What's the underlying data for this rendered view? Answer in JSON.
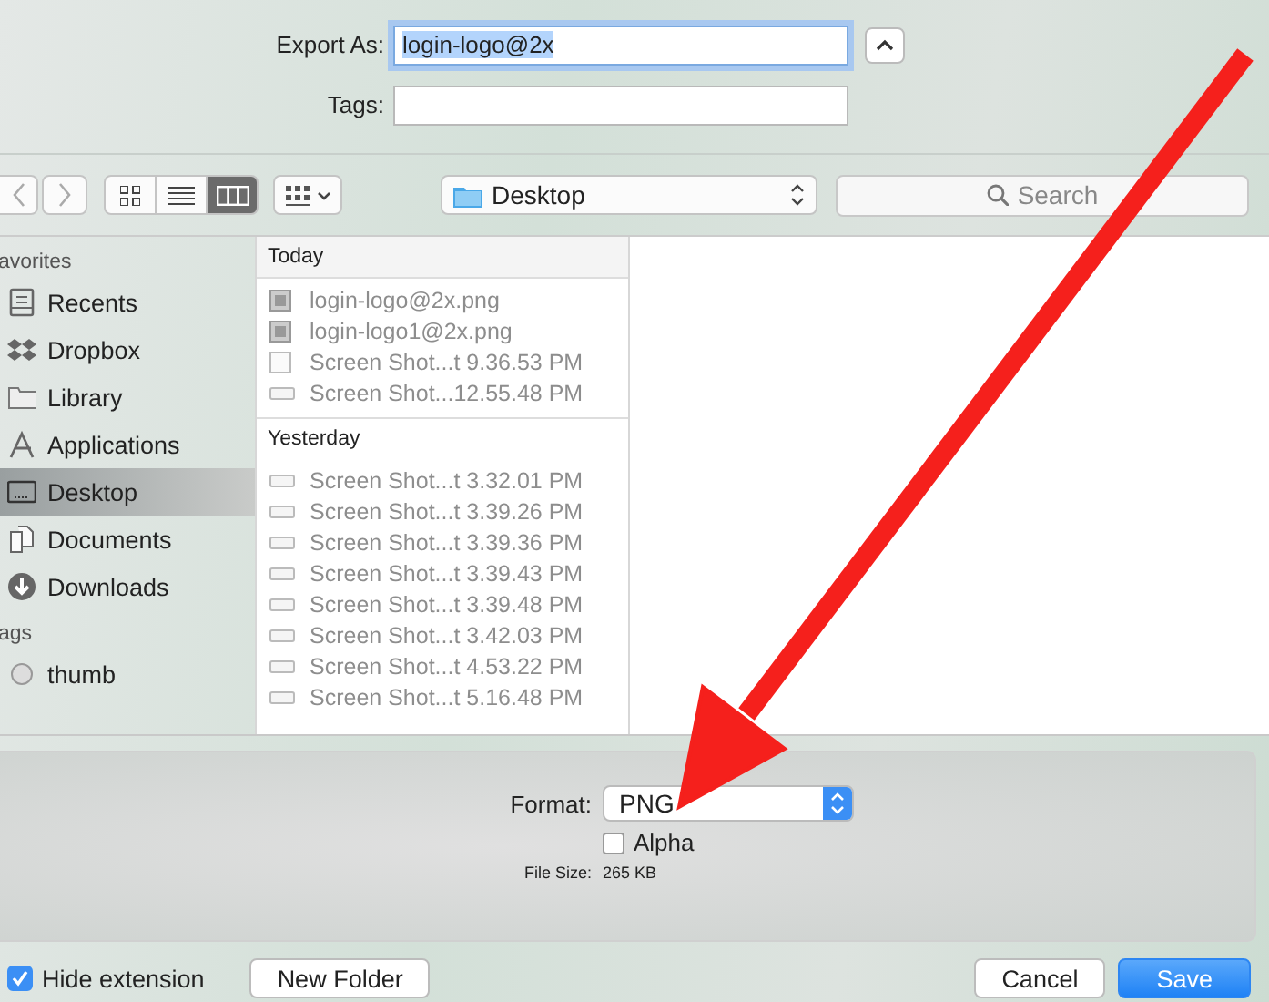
{
  "export_as": {
    "label": "Export As:",
    "value": "login-logo@2x"
  },
  "tags": {
    "label": "Tags:"
  },
  "toolbar": {
    "view_modes": [
      {
        "kind": "icons",
        "selected": false
      },
      {
        "kind": "list",
        "selected": false
      },
      {
        "kind": "columns",
        "selected": true
      }
    ],
    "location": "Desktop",
    "search": {
      "placeholder": "Search"
    }
  },
  "sidebar": {
    "sections": [
      {
        "title": "avorites",
        "items": [
          {
            "label": "Recents",
            "kind": "recents",
            "selected": false
          },
          {
            "label": "Dropbox",
            "kind": "dropbox",
            "selected": false
          },
          {
            "label": "Library",
            "kind": "folder",
            "selected": false
          },
          {
            "label": "Applications",
            "kind": "apps",
            "selected": false
          },
          {
            "label": "Desktop",
            "kind": "desktop",
            "selected": true
          },
          {
            "label": "Documents",
            "kind": "documents",
            "selected": false
          },
          {
            "label": "Downloads",
            "kind": "downloads",
            "selected": false
          }
        ]
      },
      {
        "title": "ags",
        "items": [
          {
            "label": "thumb",
            "kind": "tag",
            "selected": false
          }
        ]
      }
    ]
  },
  "files": {
    "groups": [
      {
        "title": "Today",
        "items": [
          {
            "name": "login-logo@2x.png",
            "kind": "image"
          },
          {
            "name": "login-logo1@2x.png",
            "kind": "image"
          },
          {
            "name": "Screen Shot...t 9.36.53 PM",
            "kind": "page"
          },
          {
            "name": "Screen Shot...12.55.48 PM",
            "kind": "screenshot"
          }
        ]
      },
      {
        "title": "Yesterday",
        "items": [
          {
            "name": "Screen Shot...t 3.32.01 PM",
            "kind": "screenshot"
          },
          {
            "name": "Screen Shot...t 3.39.26 PM",
            "kind": "screenshot"
          },
          {
            "name": "Screen Shot...t 3.39.36 PM",
            "kind": "screenshot"
          },
          {
            "name": "Screen Shot...t 3.39.43 PM",
            "kind": "screenshot"
          },
          {
            "name": "Screen Shot...t 3.39.48 PM",
            "kind": "screenshot"
          },
          {
            "name": "Screen Shot...t 3.42.03 PM",
            "kind": "screenshot"
          },
          {
            "name": "Screen Shot...t 4.53.22 PM",
            "kind": "screenshot"
          },
          {
            "name": "Screen Shot...t 5.16.48 PM",
            "kind": "screenshot"
          }
        ]
      }
    ]
  },
  "options": {
    "format": {
      "label": "Format:",
      "value": "PNG"
    },
    "alpha": {
      "label": "Alpha",
      "checked": false
    },
    "file_size": {
      "label": "File Size:",
      "value": "265 KB"
    }
  },
  "footer": {
    "hide_extension": {
      "label": "Hide extension",
      "checked": true
    },
    "new_folder": {
      "label": "New Folder"
    },
    "buttons": [
      {
        "label": "Cancel",
        "kind": "default"
      },
      {
        "label": "Save",
        "kind": "primary"
      }
    ]
  }
}
